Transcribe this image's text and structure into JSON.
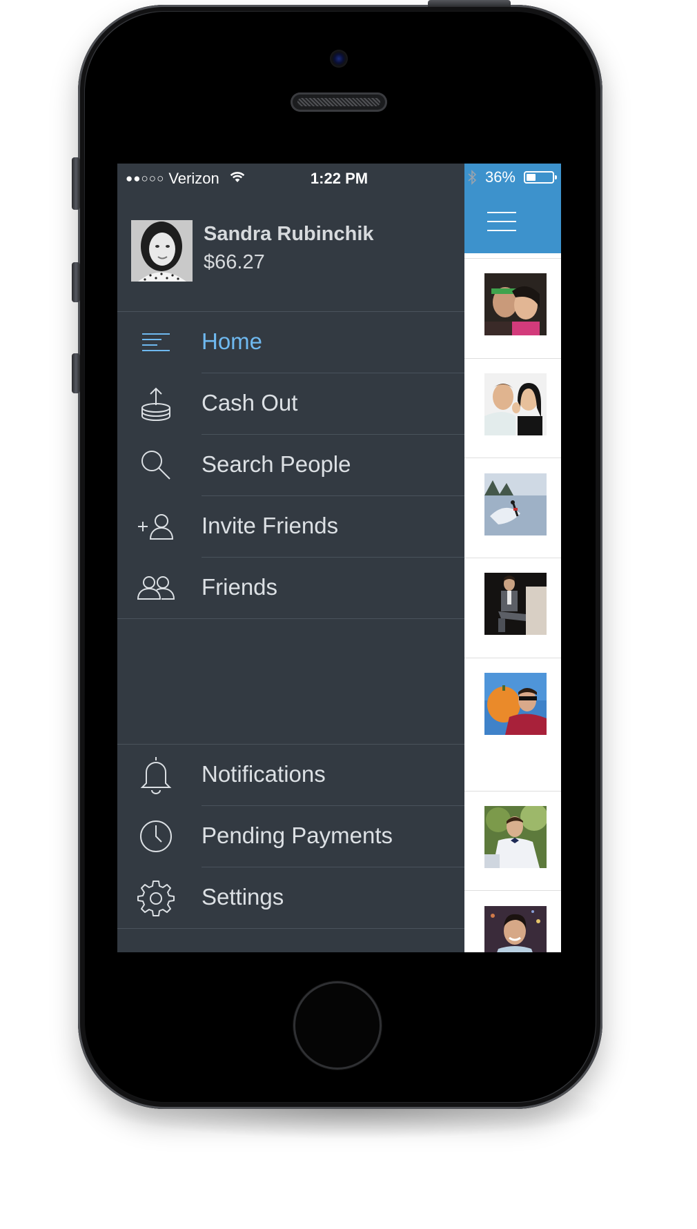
{
  "status_bar": {
    "carrier": "Verizon",
    "signal_dots": "●●○○○",
    "time": "1:22 PM",
    "battery_percent": "36%",
    "battery_level": 0.36,
    "icons": [
      "wifi-icon",
      "bluetooth-icon",
      "battery-icon"
    ]
  },
  "profile": {
    "name": "Sandra Rubinchik",
    "balance": "$66.27"
  },
  "menu": {
    "primary": [
      {
        "label": "Home",
        "icon": "home-lines-icon",
        "active": true
      },
      {
        "label": "Cash Out",
        "icon": "coin-upload-icon",
        "active": false
      },
      {
        "label": "Search People",
        "icon": "search-icon",
        "active": false
      },
      {
        "label": "Invite Friends",
        "icon": "add-person-icon",
        "active": false
      },
      {
        "label": "Friends",
        "icon": "friends-icon",
        "active": false
      }
    ],
    "secondary": [
      {
        "label": "Notifications",
        "icon": "bell-icon"
      },
      {
        "label": "Pending Payments",
        "icon": "clock-icon"
      },
      {
        "label": "Settings",
        "icon": "gear-icon"
      }
    ]
  },
  "content_pane": {
    "header_color": "#3d92cc",
    "header_icon": "hamburger-menu-icon",
    "feed_thumbnails": [
      "photo-two-friends",
      "photo-couple",
      "photo-water-skier",
      "photo-seated-man",
      "photo-man-with-pumpkin",
      "photo-man-bow-tie",
      "photo-smiling-man"
    ]
  },
  "colors": {
    "drawer_bg": "#333a42",
    "active_item": "#6fb9f0",
    "menu_text": "#dce0e4",
    "divider": "#4a535c",
    "accent_blue": "#3d92cc"
  }
}
